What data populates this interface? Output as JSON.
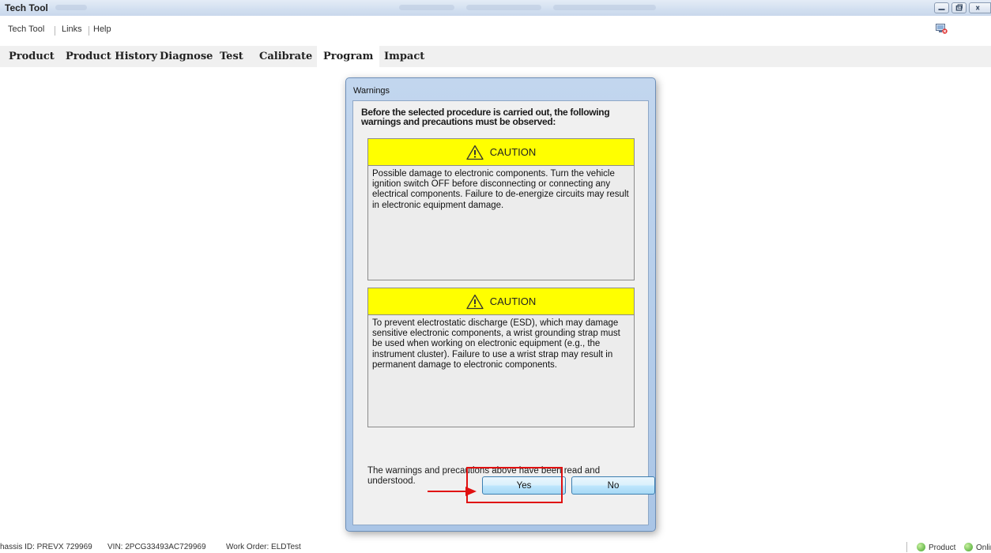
{
  "window": {
    "title": "Tech Tool"
  },
  "menu": {
    "items": [
      {
        "label": "Tech Tool"
      },
      {
        "label": "Links"
      },
      {
        "label": "Help"
      }
    ]
  },
  "tabs": [
    {
      "label": "Product"
    },
    {
      "label": "Product History"
    },
    {
      "label": "Diagnose"
    },
    {
      "label": "Test"
    },
    {
      "label": "Calibrate"
    },
    {
      "label": "Program",
      "active": true
    },
    {
      "label": "Impact"
    }
  ],
  "dialog": {
    "title": "Warnings",
    "intro": "Before the selected procedure is carried out, the following warnings and precautions must be observed:",
    "cautions": [
      {
        "heading": "CAUTION",
        "text": "Possible damage to electronic components. Turn the vehicle ignition switch OFF before disconnecting or connecting any electrical components. Failure to de-energize circuits may result in electronic equipment damage."
      },
      {
        "heading": "CAUTION",
        "text": "To prevent electrostatic discharge (ESD), which may damage sensitive electronic components, a wrist grounding strap must be used when working on electronic equipment (e.g., the instrument cluster). Failure to use a wrist strap may result in permanent damage to electronic components."
      }
    ],
    "acknowledgement": "The warnings and precautions above have been read and understood.",
    "yes_label": "Yes",
    "no_label": "No"
  },
  "status": {
    "chassis": "hassis ID: PREVX 729969",
    "vin": "VIN: 2PCG33493AC729969",
    "work_order": "Work Order: ELDTest",
    "product": "Product",
    "online": "Online"
  },
  "colors": {
    "caution_header": "#ffff00",
    "annotation_red": "#e01010",
    "status_ok": "#43a52c"
  }
}
